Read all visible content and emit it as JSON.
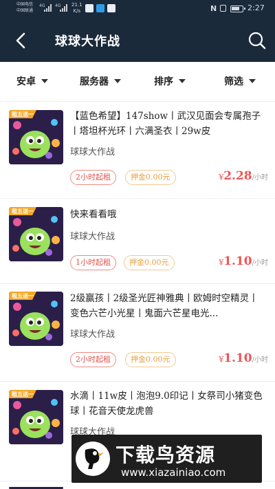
{
  "status_bar": {
    "carrier_1": "中国电信",
    "carrier_2": "中国联通",
    "network_1": "4G",
    "network_2": "4G",
    "net_speed": "21.1",
    "net_speed_unit": "K/s",
    "nfc": "N",
    "time": "2:27"
  },
  "header": {
    "title": "球球大作战",
    "back_icon": "chevron-left-icon",
    "search_icon": "search-icon"
  },
  "filters": [
    {
      "label": "安卓"
    },
    {
      "label": "服务器"
    },
    {
      "label": "排序"
    },
    {
      "label": "筛选"
    }
  ],
  "listings": [
    {
      "badge": "租五送一",
      "title": "【蓝色希望】147show丨武汉见面会专属孢子丨塔坦杯光环丨六满圣衣丨29w皮",
      "game": "球球大作战",
      "rent_tag": "2小时起租",
      "deposit_tag": "押金0.00元",
      "price": "2.28",
      "currency": "¥",
      "unit": "/小时"
    },
    {
      "badge": "租五送一",
      "title": "快来看看哦",
      "game": "球球大作战",
      "rent_tag": "1小时起租",
      "deposit_tag": "押金0.00元",
      "price": "1.10",
      "currency": "¥",
      "unit": "/小时"
    },
    {
      "badge": "租五送一",
      "title": "2级赢孩丨2级圣光匠神雅典丨欧姆时空精灵丨变色六芒小光星丨鬼面六芒星电光...",
      "game": "球球大作战",
      "rent_tag": "2小时起租",
      "deposit_tag": "押金0.00元",
      "price": "1.10",
      "currency": "¥",
      "unit": "/小时"
    },
    {
      "badge": "租五送一",
      "title": "水滴丨11w皮丨泡泡9.0印记丨女祭司小猪变色球丨花音天使龙虎兽",
      "game": "球球大作战",
      "rent_tag": "",
      "deposit_tag": "",
      "price": "",
      "currency": "",
      "unit": ""
    }
  ],
  "watermark": {
    "text": "下载鸟资源",
    "url": "www.xiazainiao.com"
  },
  "colors": {
    "header_bg": "#1b2a3b",
    "price": "#f05454",
    "rent_tag": "#e0524a",
    "deposit_tag": "#e8a23c"
  }
}
